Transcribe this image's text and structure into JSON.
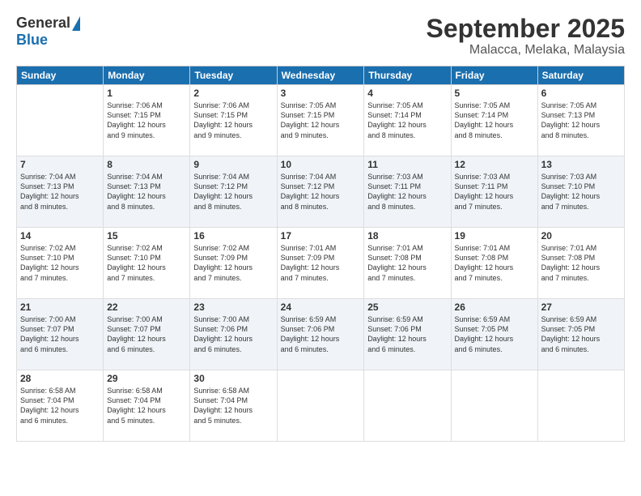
{
  "logo": {
    "general": "General",
    "blue": "Blue"
  },
  "title": "September 2025",
  "subtitle": "Malacca, Melaka, Malaysia",
  "days_of_week": [
    "Sunday",
    "Monday",
    "Tuesday",
    "Wednesday",
    "Thursday",
    "Friday",
    "Saturday"
  ],
  "weeks": [
    [
      {
        "day": "",
        "info": ""
      },
      {
        "day": "1",
        "info": "Sunrise: 7:06 AM\nSunset: 7:15 PM\nDaylight: 12 hours\nand 9 minutes."
      },
      {
        "day": "2",
        "info": "Sunrise: 7:06 AM\nSunset: 7:15 PM\nDaylight: 12 hours\nand 9 minutes."
      },
      {
        "day": "3",
        "info": "Sunrise: 7:05 AM\nSunset: 7:15 PM\nDaylight: 12 hours\nand 9 minutes."
      },
      {
        "day": "4",
        "info": "Sunrise: 7:05 AM\nSunset: 7:14 PM\nDaylight: 12 hours\nand 8 minutes."
      },
      {
        "day": "5",
        "info": "Sunrise: 7:05 AM\nSunset: 7:14 PM\nDaylight: 12 hours\nand 8 minutes."
      },
      {
        "day": "6",
        "info": "Sunrise: 7:05 AM\nSunset: 7:13 PM\nDaylight: 12 hours\nand 8 minutes."
      }
    ],
    [
      {
        "day": "7",
        "info": "Sunrise: 7:04 AM\nSunset: 7:13 PM\nDaylight: 12 hours\nand 8 minutes."
      },
      {
        "day": "8",
        "info": "Sunrise: 7:04 AM\nSunset: 7:13 PM\nDaylight: 12 hours\nand 8 minutes."
      },
      {
        "day": "9",
        "info": "Sunrise: 7:04 AM\nSunset: 7:12 PM\nDaylight: 12 hours\nand 8 minutes."
      },
      {
        "day": "10",
        "info": "Sunrise: 7:04 AM\nSunset: 7:12 PM\nDaylight: 12 hours\nand 8 minutes."
      },
      {
        "day": "11",
        "info": "Sunrise: 7:03 AM\nSunset: 7:11 PM\nDaylight: 12 hours\nand 8 minutes."
      },
      {
        "day": "12",
        "info": "Sunrise: 7:03 AM\nSunset: 7:11 PM\nDaylight: 12 hours\nand 7 minutes."
      },
      {
        "day": "13",
        "info": "Sunrise: 7:03 AM\nSunset: 7:10 PM\nDaylight: 12 hours\nand 7 minutes."
      }
    ],
    [
      {
        "day": "14",
        "info": "Sunrise: 7:02 AM\nSunset: 7:10 PM\nDaylight: 12 hours\nand 7 minutes."
      },
      {
        "day": "15",
        "info": "Sunrise: 7:02 AM\nSunset: 7:10 PM\nDaylight: 12 hours\nand 7 minutes."
      },
      {
        "day": "16",
        "info": "Sunrise: 7:02 AM\nSunset: 7:09 PM\nDaylight: 12 hours\nand 7 minutes."
      },
      {
        "day": "17",
        "info": "Sunrise: 7:01 AM\nSunset: 7:09 PM\nDaylight: 12 hours\nand 7 minutes."
      },
      {
        "day": "18",
        "info": "Sunrise: 7:01 AM\nSunset: 7:08 PM\nDaylight: 12 hours\nand 7 minutes."
      },
      {
        "day": "19",
        "info": "Sunrise: 7:01 AM\nSunset: 7:08 PM\nDaylight: 12 hours\nand 7 minutes."
      },
      {
        "day": "20",
        "info": "Sunrise: 7:01 AM\nSunset: 7:08 PM\nDaylight: 12 hours\nand 7 minutes."
      }
    ],
    [
      {
        "day": "21",
        "info": "Sunrise: 7:00 AM\nSunset: 7:07 PM\nDaylight: 12 hours\nand 6 minutes."
      },
      {
        "day": "22",
        "info": "Sunrise: 7:00 AM\nSunset: 7:07 PM\nDaylight: 12 hours\nand 6 minutes."
      },
      {
        "day": "23",
        "info": "Sunrise: 7:00 AM\nSunset: 7:06 PM\nDaylight: 12 hours\nand 6 minutes."
      },
      {
        "day": "24",
        "info": "Sunrise: 6:59 AM\nSunset: 7:06 PM\nDaylight: 12 hours\nand 6 minutes."
      },
      {
        "day": "25",
        "info": "Sunrise: 6:59 AM\nSunset: 7:06 PM\nDaylight: 12 hours\nand 6 minutes."
      },
      {
        "day": "26",
        "info": "Sunrise: 6:59 AM\nSunset: 7:05 PM\nDaylight: 12 hours\nand 6 minutes."
      },
      {
        "day": "27",
        "info": "Sunrise: 6:59 AM\nSunset: 7:05 PM\nDaylight: 12 hours\nand 6 minutes."
      }
    ],
    [
      {
        "day": "28",
        "info": "Sunrise: 6:58 AM\nSunset: 7:04 PM\nDaylight: 12 hours\nand 6 minutes."
      },
      {
        "day": "29",
        "info": "Sunrise: 6:58 AM\nSunset: 7:04 PM\nDaylight: 12 hours\nand 5 minutes."
      },
      {
        "day": "30",
        "info": "Sunrise: 6:58 AM\nSunset: 7:04 PM\nDaylight: 12 hours\nand 5 minutes."
      },
      {
        "day": "",
        "info": ""
      },
      {
        "day": "",
        "info": ""
      },
      {
        "day": "",
        "info": ""
      },
      {
        "day": "",
        "info": ""
      }
    ]
  ]
}
